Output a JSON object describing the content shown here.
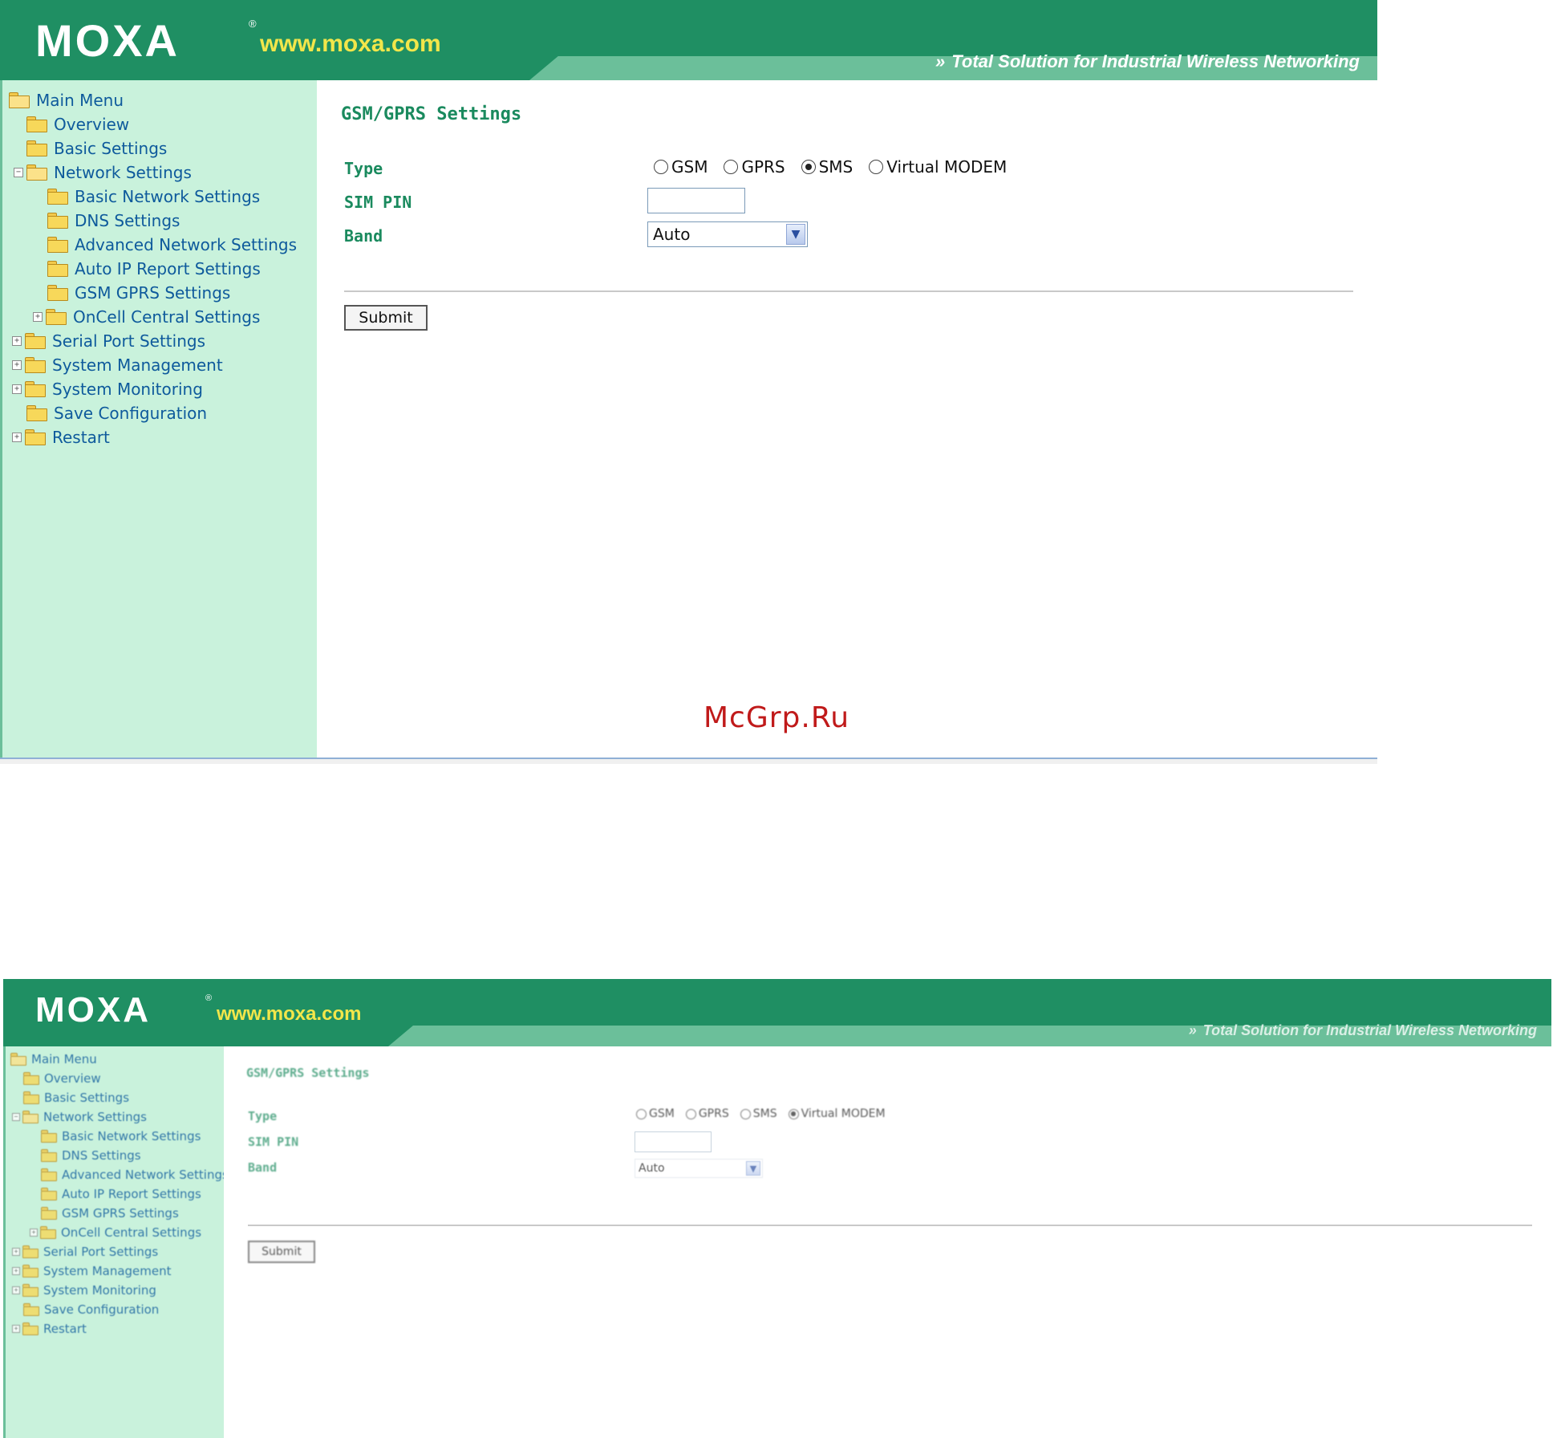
{
  "header": {
    "logo_text": "MOXA",
    "logo_mark": "®",
    "url": "www.moxa.com",
    "tagline_arrows": "»",
    "tagline": "Total Solution for Industrial Wireless Networking"
  },
  "menu": [
    {
      "label": "Main Menu",
      "expander": "",
      "open": true
    },
    {
      "label": "Overview",
      "expander": "",
      "open": false
    },
    {
      "label": "Basic Settings",
      "expander": "",
      "open": false
    },
    {
      "label": "Network Settings",
      "expander": "−",
      "open": true
    },
    {
      "label": "Basic Network Settings",
      "expander": "",
      "open": false
    },
    {
      "label": "DNS Settings",
      "expander": "",
      "open": false
    },
    {
      "label": "Advanced Network Settings",
      "expander": "",
      "open": false
    },
    {
      "label": "Auto IP Report Settings",
      "expander": "",
      "open": false
    },
    {
      "label": "GSM GPRS Settings",
      "expander": "",
      "open": false
    },
    {
      "label": "OnCell Central Settings",
      "expander": "+",
      "open": false
    },
    {
      "label": "Serial Port Settings",
      "expander": "+",
      "open": false
    },
    {
      "label": "System Management",
      "expander": "+",
      "open": false
    },
    {
      "label": "System Monitoring",
      "expander": "+",
      "open": false
    },
    {
      "label": "Save Configuration",
      "expander": "",
      "open": false
    },
    {
      "label": "Restart",
      "expander": "+",
      "open": false
    }
  ],
  "form": {
    "title": "GSM/GPRS Settings",
    "type_label": "Type",
    "type_options": [
      {
        "label": "GSM",
        "checked": false
      },
      {
        "label": "GPRS",
        "checked": false
      },
      {
        "label": "SMS",
        "checked": true
      },
      {
        "label": "Virtual MODEM",
        "checked": false
      }
    ],
    "sim_pin_label": "SIM PIN",
    "sim_pin_value": "",
    "band_label": "Band",
    "band_value": "Auto",
    "submit_label": "Submit"
  },
  "bottom_form": {
    "type_options": [
      {
        "label": "GSM",
        "checked": false
      },
      {
        "label": "GPRS",
        "checked": false
      },
      {
        "label": "SMS",
        "checked": false
      },
      {
        "label": "Virtual MODEM",
        "checked": true
      }
    ],
    "band_value": "Auto"
  },
  "watermark": "McGrp.Ru",
  "colors": {
    "header": "#1f8f63",
    "header_band": "#6bbf9a",
    "url": "#f2e64a",
    "sidebar": "#c9f2dc",
    "menu_text": "#0e5a9c",
    "label": "#1a8a5e",
    "watermark": "#c01a1a"
  },
  "icons": {
    "menu_item": "folder-icon",
    "radio": "radio-button",
    "select": "chevron-down-icon"
  }
}
